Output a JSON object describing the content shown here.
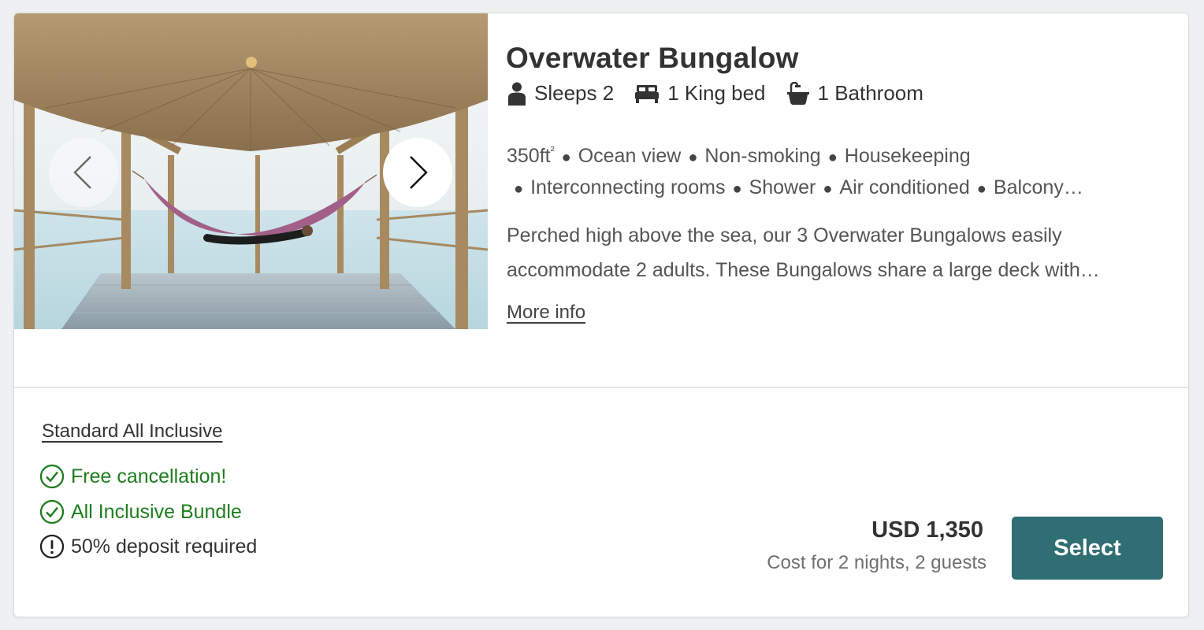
{
  "room": {
    "title": "Overwater Bungalow",
    "specs": {
      "sleeps": "Sleeps 2",
      "bed": "1 King bed",
      "bathroom": "1 Bathroom"
    },
    "amenities": {
      "size_value": "350ft",
      "size_sup": "²",
      "line1": [
        "Ocean view",
        "Non-smoking",
        "Housekeeping"
      ],
      "line2": [
        "Interconnecting rooms",
        "Shower",
        "Air conditioned",
        "Balcony…"
      ]
    },
    "description": "Perched high above the sea, our 3 Overwater Bungalows easily accommodate 2 adults. These Bungalows share a large deck with…",
    "more_info_label": "More info",
    "icons": {
      "sleeps": "person-icon",
      "bed": "bed-icon",
      "bathroom": "bathtub-icon",
      "prev": "chevron-left-icon",
      "next": "chevron-right-icon"
    }
  },
  "rate": {
    "name": "Standard All Inclusive",
    "features": [
      {
        "text": "Free cancellation!",
        "icon": "check-circle-icon",
        "color": "#1e7d1e"
      },
      {
        "text": "All Inclusive Bundle",
        "icon": "check-circle-icon",
        "color": "#1e7d1e"
      },
      {
        "text": "50% deposit required",
        "icon": "exclamation-circle-icon",
        "color": "#333333"
      }
    ],
    "price": "USD 1,350",
    "price_note": "Cost for 2 nights, 2 guests",
    "select_label": "Select"
  },
  "colors": {
    "accent": "#2f6e73",
    "success": "#1e7d1e",
    "text": "#333333",
    "muted": "#707070"
  }
}
